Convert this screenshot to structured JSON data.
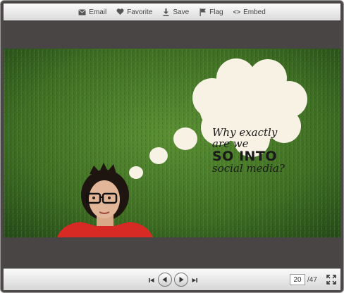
{
  "toolbar": {
    "email_label": "Email",
    "favorite_label": "Favorite",
    "save_label": "Save",
    "flag_label": "Flag",
    "embed_label": "Embed",
    "embed_icon": "<>"
  },
  "slide": {
    "line1": "Why exactly",
    "line2": "are we",
    "line3": "SO INTO",
    "line4": "social media?"
  },
  "pager": {
    "current_page": "20",
    "total_label": "/47"
  },
  "icons": {
    "email": "envelope-icon",
    "favorite": "heart-icon",
    "save": "download-icon",
    "flag": "flag-icon",
    "embed": "code-icon",
    "first": "skip-back-icon",
    "prev": "previous-icon",
    "next": "next-icon",
    "last": "skip-forward-icon",
    "fullscreen": "fullscreen-icon"
  },
  "colors": {
    "grass": "#3f6e24",
    "shirt": "#d82a24",
    "bubble": "#f7f2e4",
    "chrome_bg": "#4a4746"
  }
}
